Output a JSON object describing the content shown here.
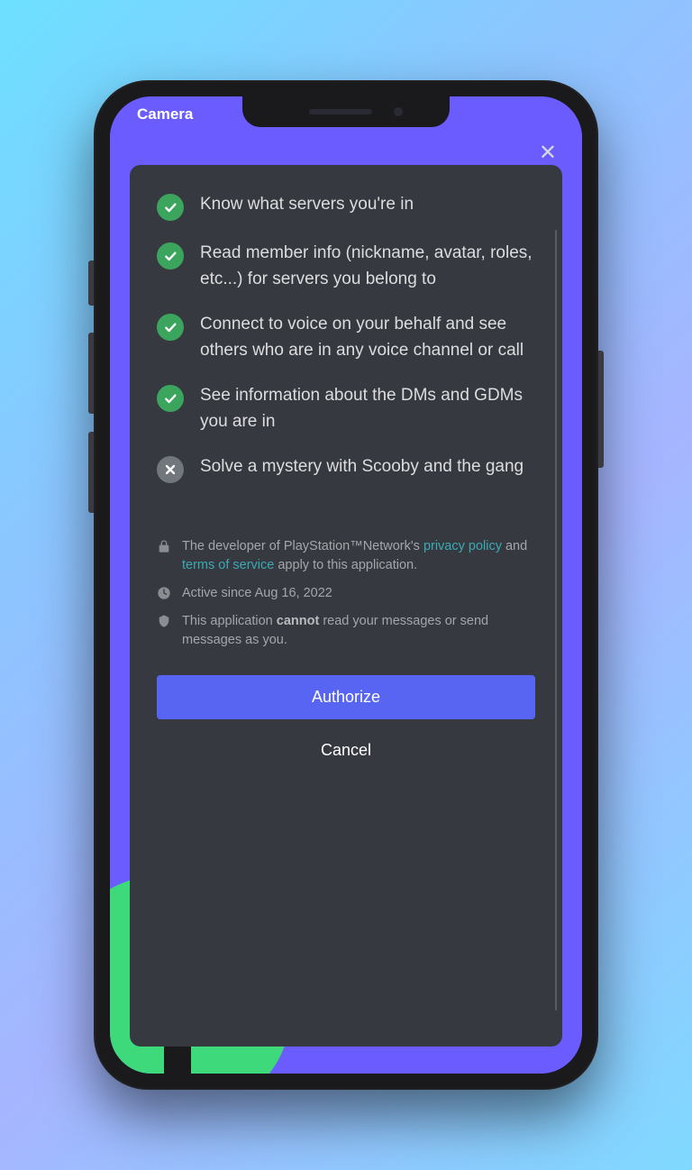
{
  "header": {
    "title": "Camera"
  },
  "permissions": [
    {
      "type": "allow",
      "text": "Know what servers you're in"
    },
    {
      "type": "allow",
      "text": "Read member info (nickname, avatar, roles, etc...) for servers you belong to"
    },
    {
      "type": "allow",
      "text": "Connect to voice on your behalf and see others who are in any voice channel or call"
    },
    {
      "type": "allow",
      "text": "See information about the DMs and GDMs you are in"
    },
    {
      "type": "deny",
      "text": "Solve a mystery with Scooby and the gang"
    }
  ],
  "footer": {
    "policy_prefix": "The developer of PlayStation™Network's ",
    "privacy_link": "privacy policy",
    "policy_mid": " and ",
    "tos_link": "terms of service",
    "policy_suffix": " apply to this application.",
    "active": "Active since Aug 16, 2022",
    "security_prefix": "This application ",
    "security_strong": "cannot",
    "security_suffix": " read your messages or send messages as you."
  },
  "buttons": {
    "authorize": "Authorize",
    "cancel": "Cancel"
  }
}
